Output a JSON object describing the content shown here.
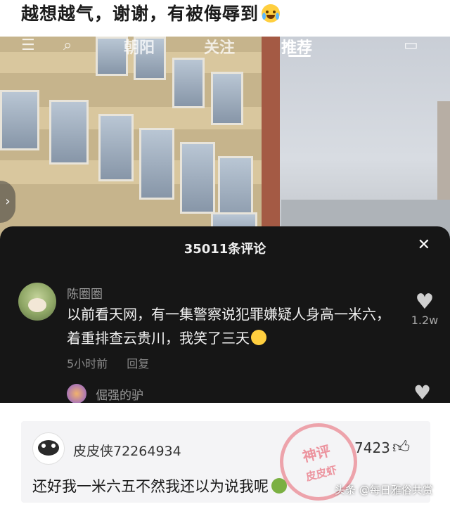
{
  "headline": {
    "text": "越想越气，谢谢，有被侮辱到"
  },
  "video": {
    "tabs": [
      "朝阳",
      "关注",
      "推荐"
    ],
    "active_tab": "推荐",
    "icons": [
      "menu-icon",
      "search-icon",
      "tv-icon"
    ]
  },
  "comment_panel": {
    "title": "35011条评论",
    "close_icon": "close-icon",
    "comment": {
      "username": "陈圈圈",
      "text": "以前看天网，有一集警察说犯罪嫌疑人身高一米六，着重排查云贵川，我笑了三天",
      "time": "5小时前",
      "reply_label": "回复",
      "like_count": "1.2w"
    },
    "next_comment": {
      "username": "倔强的驴"
    }
  },
  "bottom_comment": {
    "username": "皮皮侠72264934",
    "like_count": "7423",
    "text": "还好我一米六五不然我还以为说我呢"
  },
  "watermark": {
    "text": "头条 @每日雅俗共赏"
  },
  "stamp": {
    "line1": "神评",
    "line2": "皮皮虾"
  },
  "colors": {
    "panel_bg": "#161616",
    "stamp": "#e8606e"
  }
}
